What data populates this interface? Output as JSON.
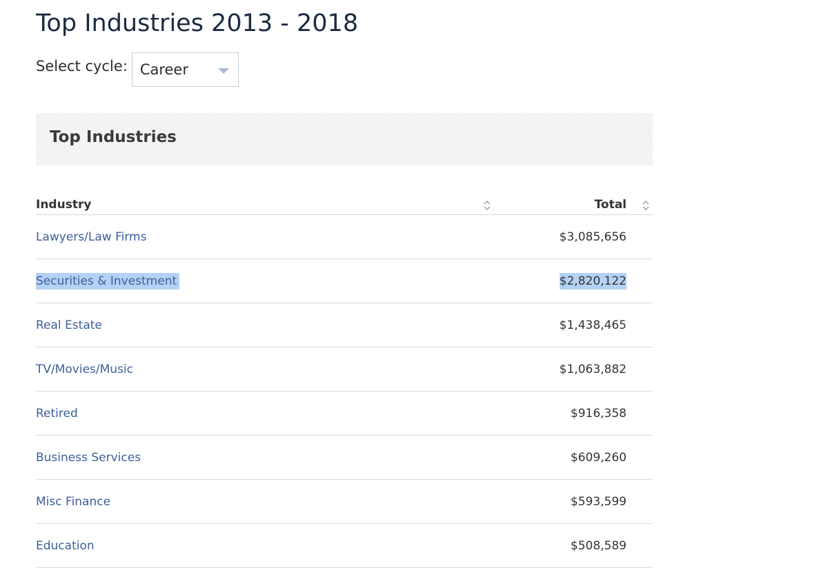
{
  "page": {
    "title": "Top Industries 2013 - 2018"
  },
  "cycle": {
    "label": "Select cycle:",
    "selected": "Career"
  },
  "panel": {
    "title": "Top Industries"
  },
  "table": {
    "headers": {
      "industry": "Industry",
      "total": "Total"
    },
    "rows": [
      {
        "industry": "Lawyers/Law Firms",
        "total": "$3,085,656"
      },
      {
        "industry": "Securities & Investment",
        "total": "$2,820,122"
      },
      {
        "industry": "Real Estate",
        "total": "$1,438,465"
      },
      {
        "industry": "TV/Movies/Music",
        "total": "$1,063,882"
      },
      {
        "industry": "Retired",
        "total": "$916,358"
      },
      {
        "industry": "Business Services",
        "total": "$609,260"
      },
      {
        "industry": "Misc Finance",
        "total": "$593,599"
      },
      {
        "industry": "Education",
        "total": "$508,589"
      }
    ]
  },
  "icons": {
    "select_caret": "caret-down-icon",
    "sort": "sort-icon"
  },
  "colors": {
    "link": "#3d5f99",
    "selection_highlight": "#b4d2f5",
    "caret": "#a9bbd0"
  }
}
